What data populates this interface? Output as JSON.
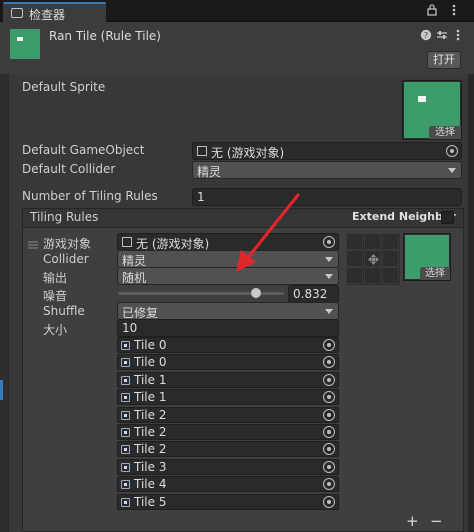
{
  "tab": {
    "label": "检查器",
    "icon": "inspector-icon"
  },
  "tab_actions": {
    "lock_icon": "lock-icon",
    "menu_icon": "kebab-menu-icon"
  },
  "header": {
    "title": "Ran Tile (Rule Tile)",
    "open_button": "打开",
    "icons": [
      "help-icon",
      "preset-icon",
      "more-icon"
    ]
  },
  "default_sprite": {
    "label": "Default Sprite",
    "select_label": "选择"
  },
  "default_gameobject": {
    "label": "Default GameObject",
    "value": "无 (游戏对象)"
  },
  "default_collider": {
    "label": "Default Collider",
    "value": "精灵"
  },
  "tiling_rules_count": {
    "label": "Number of Tiling Rules",
    "value": "1"
  },
  "tiling_rules": {
    "header": "Tiling Rules",
    "extend_neighbor": "Extend Neighbor",
    "rule": {
      "gameobject_label": "游戏对象",
      "gameobject_value": "无 (游戏对象)",
      "collider_label": "Collider",
      "collider_value": "精灵",
      "output_label": "输出",
      "output_value": "随机",
      "noise_label": "噪音",
      "noise_value": "0.832",
      "noise_fraction": 0.832,
      "shuffle_label": "Shuffle",
      "shuffle_value": "已修复",
      "size_label": "大小",
      "size_value": "10",
      "sprite_select_label": "选择",
      "tiles": [
        "Tile 0",
        "Tile 0",
        "Tile 1",
        "Tile 1",
        "Tile 2",
        "Tile 2",
        "Tile 2",
        "Tile 3",
        "Tile 4",
        "Tile 5"
      ]
    }
  },
  "footer": {
    "add": "+",
    "remove": "−"
  },
  "colors": {
    "accent": "#3a79bb",
    "tile_green": "#3c9c6c",
    "arrow_red": "#e0262a"
  }
}
